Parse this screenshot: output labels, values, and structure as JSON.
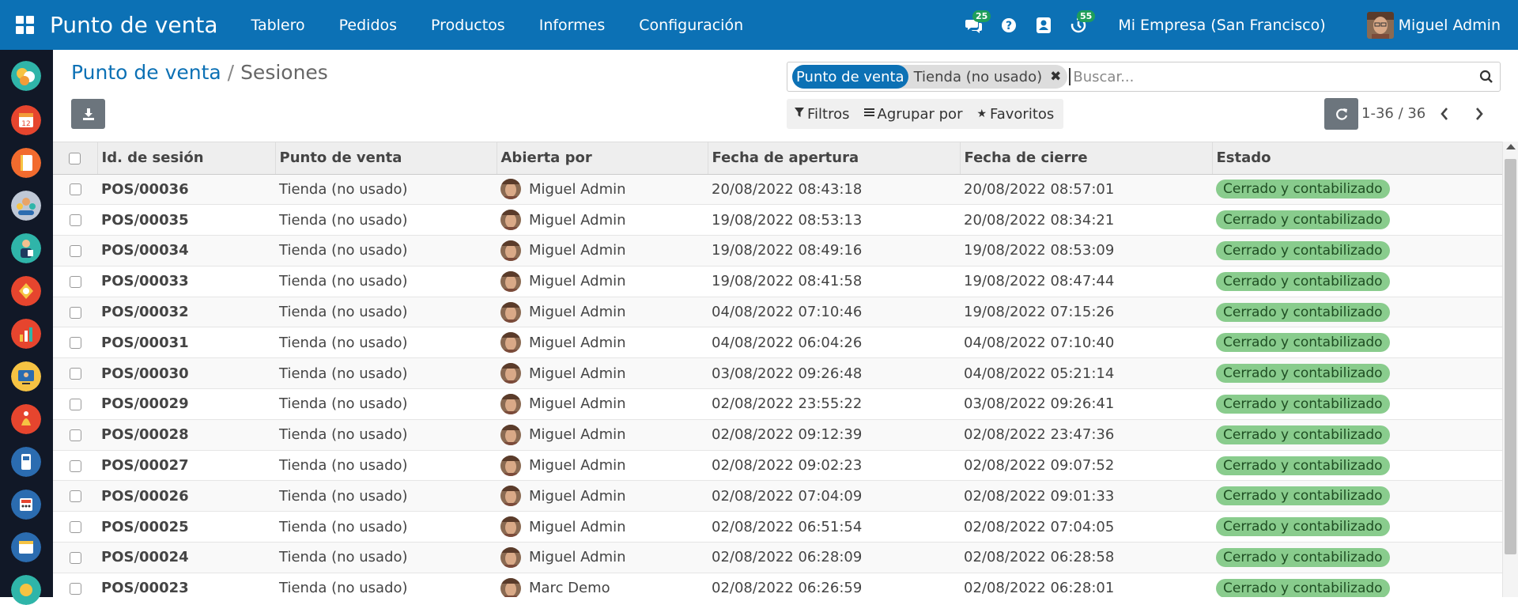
{
  "navbar": {
    "brand": "Punto de venta",
    "menu": [
      "Tablero",
      "Pedidos",
      "Productos",
      "Informes",
      "Configuración"
    ],
    "messages_count": "25",
    "activities_count": "55",
    "company": "Mi Empresa (San Francisco)",
    "user": "Miguel Admin"
  },
  "breadcrumb": {
    "parent": "Punto de venta",
    "separator": "/",
    "current": "Sesiones"
  },
  "search": {
    "facet_label": "Punto de venta",
    "facet_value": "Tienda (no usado)",
    "placeholder": "Buscar..."
  },
  "filters": {
    "filters": "Filtros",
    "group_by": "Agrupar por",
    "favorites": "Favoritos"
  },
  "pager": {
    "value": "1-36 / 36"
  },
  "table": {
    "columns": [
      "Id. de sesión",
      "Punto de venta",
      "Abierta por",
      "Fecha de apertura",
      "Fecha de cierre",
      "Estado"
    ],
    "rows": [
      {
        "id": "POS/00036",
        "pos": "Tienda (no usado)",
        "user": "Miguel Admin",
        "opened": "20/08/2022 08:43:18",
        "closed": "20/08/2022 08:57:01",
        "state": "Cerrado y contabilizado"
      },
      {
        "id": "POS/00035",
        "pos": "Tienda (no usado)",
        "user": "Miguel Admin",
        "opened": "19/08/2022 08:53:13",
        "closed": "20/08/2022 08:34:21",
        "state": "Cerrado y contabilizado"
      },
      {
        "id": "POS/00034",
        "pos": "Tienda (no usado)",
        "user": "Miguel Admin",
        "opened": "19/08/2022 08:49:16",
        "closed": "19/08/2022 08:53:09",
        "state": "Cerrado y contabilizado"
      },
      {
        "id": "POS/00033",
        "pos": "Tienda (no usado)",
        "user": "Miguel Admin",
        "opened": "19/08/2022 08:41:58",
        "closed": "19/08/2022 08:47:44",
        "state": "Cerrado y contabilizado"
      },
      {
        "id": "POS/00032",
        "pos": "Tienda (no usado)",
        "user": "Miguel Admin",
        "opened": "04/08/2022 07:10:46",
        "closed": "19/08/2022 07:15:26",
        "state": "Cerrado y contabilizado"
      },
      {
        "id": "POS/00031",
        "pos": "Tienda (no usado)",
        "user": "Miguel Admin",
        "opened": "04/08/2022 06:04:26",
        "closed": "04/08/2022 07:10:40",
        "state": "Cerrado y contabilizado"
      },
      {
        "id": "POS/00030",
        "pos": "Tienda (no usado)",
        "user": "Miguel Admin",
        "opened": "03/08/2022 09:26:48",
        "closed": "04/08/2022 05:21:14",
        "state": "Cerrado y contabilizado"
      },
      {
        "id": "POS/00029",
        "pos": "Tienda (no usado)",
        "user": "Miguel Admin",
        "opened": "02/08/2022 23:55:22",
        "closed": "03/08/2022 09:26:41",
        "state": "Cerrado y contabilizado"
      },
      {
        "id": "POS/00028",
        "pos": "Tienda (no usado)",
        "user": "Miguel Admin",
        "opened": "02/08/2022 09:12:39",
        "closed": "02/08/2022 23:47:36",
        "state": "Cerrado y contabilizado"
      },
      {
        "id": "POS/00027",
        "pos": "Tienda (no usado)",
        "user": "Miguel Admin",
        "opened": "02/08/2022 09:02:23",
        "closed": "02/08/2022 09:07:52",
        "state": "Cerrado y contabilizado"
      },
      {
        "id": "POS/00026",
        "pos": "Tienda (no usado)",
        "user": "Miguel Admin",
        "opened": "02/08/2022 07:04:09",
        "closed": "02/08/2022 09:01:33",
        "state": "Cerrado y contabilizado"
      },
      {
        "id": "POS/00025",
        "pos": "Tienda (no usado)",
        "user": "Miguel Admin",
        "opened": "02/08/2022 06:51:54",
        "closed": "02/08/2022 07:04:05",
        "state": "Cerrado y contabilizado"
      },
      {
        "id": "POS/00024",
        "pos": "Tienda (no usado)",
        "user": "Miguel Admin",
        "opened": "02/08/2022 06:28:09",
        "closed": "02/08/2022 06:28:58",
        "state": "Cerrado y contabilizado"
      },
      {
        "id": "POS/00023",
        "pos": "Tienda (no usado)",
        "user": "Marc Demo",
        "opened": "02/08/2022 06:26:59",
        "closed": "02/08/2022 06:28:01",
        "state": "Cerrado y contabilizado"
      }
    ]
  },
  "colors": {
    "navbar": "#0c71b5",
    "appbar": "#111827",
    "status_done": "#89cc8d",
    "badge": "#1f9e5b"
  },
  "icons": [
    "apps-grid-icon",
    "chat-icon",
    "help-icon",
    "contacts-icon",
    "activity-clock-icon",
    "download-icon",
    "search-icon",
    "filter-icon",
    "group-by-icon",
    "star-icon",
    "refresh-icon",
    "chevron-left-icon",
    "chevron-right-icon",
    "remove-facet-icon"
  ]
}
